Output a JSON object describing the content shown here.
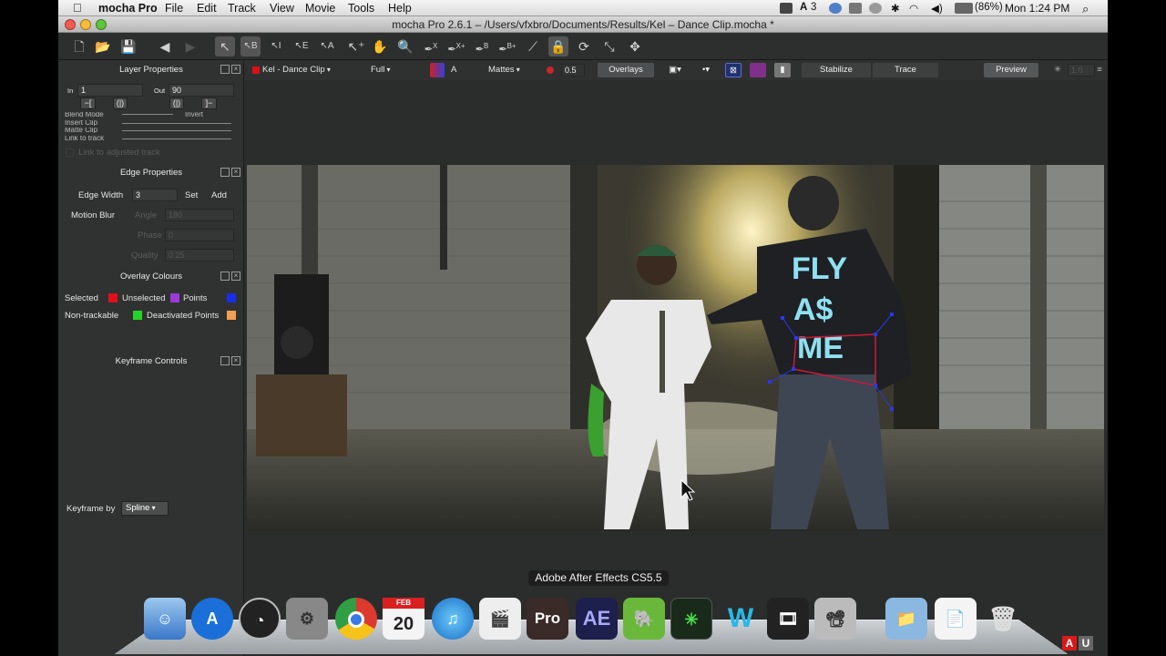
{
  "menubar": {
    "app_name": "mocha Pro",
    "menus": [
      "File",
      "Edit",
      "Track",
      "View",
      "Movie",
      "Tools",
      "Help"
    ],
    "status_number": "3",
    "battery": "(86%)",
    "clock": "Mon 1:24 PM"
  },
  "window": {
    "title": "mocha Pro 2.6.1 – /Users/vfxbro/Documents/Results/Kel – Dance Clip.mocha *"
  },
  "toolbar": {
    "tools": [
      {
        "glyph": "↖",
        "name": "select-tool",
        "active": true
      },
      {
        "glyph": "↖B",
        "name": "select-b-tool",
        "active": true
      },
      {
        "glyph": "↖I",
        "name": "select-i-tool",
        "active": false
      },
      {
        "glyph": "↖E",
        "name": "select-e-tool",
        "active": false
      },
      {
        "glyph": "↖A",
        "name": "select-a-tool",
        "active": false
      }
    ]
  },
  "layer_properties": {
    "title": "Layer Properties",
    "in_label": "In",
    "in_value": "1",
    "out_label": "Out",
    "out_value": "90",
    "in_btn_1": "−[",
    "in_btn_2": "(|)",
    "out_btn_1": "(|)",
    "out_btn_2": "]−",
    "blend_mode": "Blend Mode",
    "invert": "Invert",
    "insert_clip": "Insert Clip",
    "matte_clip": "Matte Clip",
    "link_to_track": "Link to track",
    "link_adjusted": "Link to adjusted track"
  },
  "edge_properties": {
    "title": "Edge Properties",
    "edge_width_label": "Edge Width",
    "edge_width_value": "3",
    "set": "Set",
    "add": "Add",
    "motion_blur": "Motion Blur",
    "angle_label": "Angle",
    "angle_value": "180",
    "phase_label": "Phase",
    "phase_value": "0",
    "quality_label": "Quality",
    "quality_value": "0.25"
  },
  "overlay_colours": {
    "title": "Overlay Colours",
    "selected": "Selected",
    "unselected": "Unselected",
    "points": "Points",
    "non_trackable": "Non-trackable",
    "deactivated_points": "Deactivated Points",
    "colors": {
      "selected": "#e0101a",
      "unselected": "#9b3ad8",
      "points": "#1a2de8",
      "non_trackable": "#24d428",
      "deactivated": "#f0a050"
    }
  },
  "keyframe_controls": {
    "title": "Keyframe Controls",
    "keyframe_by": "Keyframe by",
    "mode": "Spline"
  },
  "controls": {
    "layer_name": "Kel - Dance Clip",
    "resolution": "Full",
    "channel_a": "A",
    "mattes": "Mattes",
    "opacity": "0.5",
    "overlays": "Overlays",
    "stabilize": "Stabilize",
    "trace": "Trace",
    "preview": "Preview",
    "disabled_value": "1.0"
  },
  "viewer": {
    "shirt_text_1": "FLY",
    "shirt_text_2": "A$",
    "shirt_text_3": "ME"
  },
  "dock": {
    "tooltip": "Adobe After Effects CS5.5",
    "calendar_month": "FEB",
    "calendar_day": "20",
    "pro_label": "Pro",
    "ae_label": "AE",
    "w_label": "W",
    "a_label": "A",
    "u_label": "U"
  }
}
